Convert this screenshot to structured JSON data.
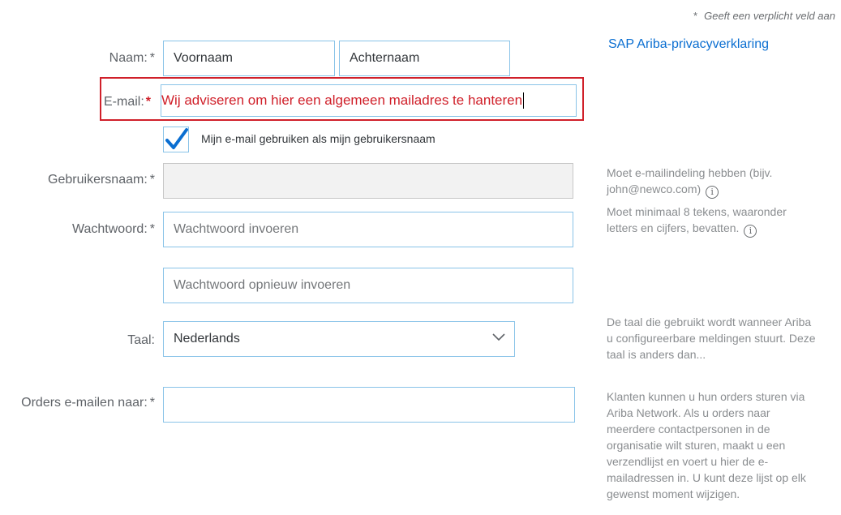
{
  "required_note": {
    "star": "*",
    "text": "Geeft een verplicht veld aan"
  },
  "privacy_link": "SAP Ariba-privacyverklaring",
  "name": {
    "label": "Naam:",
    "req": "*",
    "first_placeholder": "Voornaam",
    "last_placeholder": "Achternaam"
  },
  "email": {
    "label": "E-mail:",
    "req": "*",
    "value": "Wij adviseren om hier een algemeen mailadres te hanteren"
  },
  "use_email_checkbox": {
    "label": "Mijn e-mail gebruiken als mijn gebruikersnaam",
    "checked": true
  },
  "username": {
    "label": "Gebruikersnaam:",
    "req": "*",
    "help": "Moet e-mailindeling hebben (bijv. john@newco.com)"
  },
  "password": {
    "label": "Wachtwoord:",
    "req": "*",
    "placeholder": "Wachtwoord invoeren",
    "confirm_placeholder": "Wachtwoord opnieuw invoeren",
    "help": "Moet minimaal 8 tekens, waaronder letters en cijfers, bevatten."
  },
  "language": {
    "label": "Taal:",
    "value": "Nederlands",
    "help": "De taal die gebruikt wordt wanneer Ariba u configureerbare meldingen stuurt. Deze taal is anders dan..."
  },
  "orders_email": {
    "label": "Orders e-mailen naar:",
    "req": "*",
    "help": "Klanten kunnen u hun orders sturen via Ariba Network. Als u orders naar meerdere contactpersonen in de organisatie wilt sturen, maakt u een verzendlijst en voert u hier de e-mailadressen in. U kunt deze lijst op elk gewenst moment wijzigen."
  },
  "icons": {
    "info": "info-icon",
    "check": "checkmark-icon",
    "chevron": "chevron-down-icon"
  },
  "colors": {
    "link": "#0a6ed1",
    "highlight": "#d0202a",
    "field_border": "#89c3e8"
  }
}
